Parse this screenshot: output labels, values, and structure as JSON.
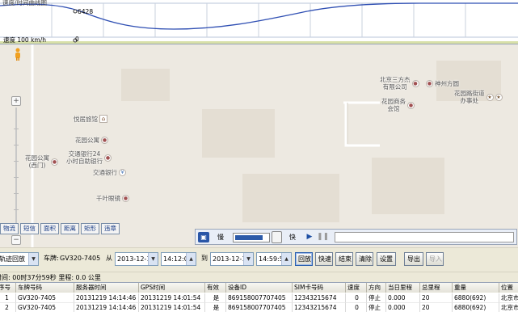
{
  "chart": {
    "top_label": "速度/时间曲线图",
    "marker_value": "6428",
    "speed_label": "速度 100 km/h",
    "zero_label": "0"
  },
  "map": {
    "zoom_in": "+",
    "zoom_out": "−",
    "pois": [
      {
        "label": "北京三方杰\n有限公司",
        "icon": "building-icon"
      },
      {
        "label": "神州方圆",
        "icon": "building-icon"
      },
      {
        "label": "花园商务\n会馆",
        "icon": "building-icon"
      },
      {
        "label": "花园路街道\n办事处",
        "icon": "government-icon"
      },
      {
        "label": "悦居旅馆",
        "icon": "hotel-icon"
      },
      {
        "label": "花园公寓",
        "icon": "building-icon"
      },
      {
        "label": "花园公寓\n(西门)",
        "icon": "building-icon"
      },
      {
        "label": "交通银行24\n小时自助银行",
        "icon": "bank-icon"
      },
      {
        "label": "交通银行",
        "icon": "yen-icon"
      },
      {
        "label": "千叶眼镜",
        "icon": "shop-icon"
      }
    ],
    "tools": [
      "物流",
      "短信",
      "面积",
      "距离",
      "矩形",
      "违章"
    ]
  },
  "playback": {
    "slow_label": "慢",
    "fast_label": "快",
    "speed_fraction": 0.85,
    "play_icon": "play-icon",
    "pause_icon": "pause-icon"
  },
  "toolbar": {
    "mode_value": "轨迹回放",
    "plate_label": "车牌:",
    "plate_value": "GV320-7405",
    "from_label": "从",
    "from_date": "2013-12-19",
    "from_time": "14:12:00",
    "to_label": "到",
    "to_date": "2013-12-19",
    "to_time": "14:59:59",
    "buttons": [
      "回放",
      "快速",
      "结束",
      "清除",
      "设置",
      "导出",
      "导入"
    ]
  },
  "summary": {
    "text": "时间: 00时37分59秒 里程: 0.0 公里"
  },
  "table": {
    "columns": [
      "序号",
      "车牌号码",
      "服务器时间",
      "GPS时间",
      "有效",
      "设备ID",
      "SIM卡号码",
      "速度",
      "方向",
      "当日里程",
      "总里程",
      "重量",
      "位置"
    ],
    "rows": [
      [
        "1",
        "GV320-7405",
        "20131219 14:14:46",
        "20131219 14:01:54",
        "是",
        "869158007707405",
        "12343215674",
        "0",
        "停止",
        "0.000",
        "20",
        "6880(692)",
        "北京市"
      ],
      [
        "2",
        "GV320-7405",
        "20131219 14:14:46",
        "20131219 14:01:54",
        "是",
        "869158007707405",
        "12343215674",
        "0",
        "停止",
        "0.000",
        "20",
        "6880(692)",
        "北京市"
      ]
    ]
  },
  "colors": {
    "accent": "#2a56a7",
    "curve": "#2f4fb3",
    "map_bg": "#ede9e1"
  }
}
